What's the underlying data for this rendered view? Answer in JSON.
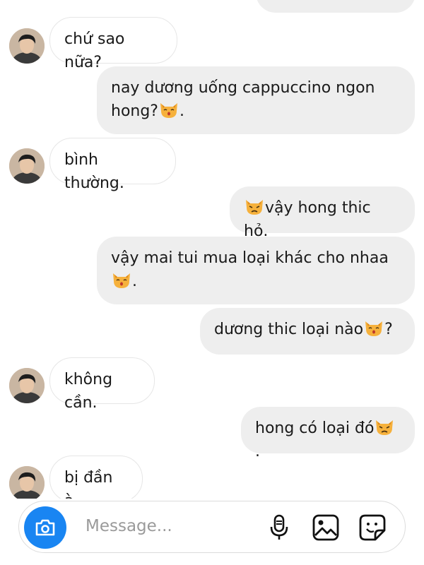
{
  "messages": [
    {
      "side": "out",
      "text": ""
    },
    {
      "side": "in",
      "text": "chứ sao nữa?"
    },
    {
      "side": "out",
      "text": "nay dương uống cappuccino ngon",
      "text2": "hong?",
      "after_emoji": "."
    },
    {
      "side": "in",
      "text": "bình thường."
    },
    {
      "side": "out",
      "text": "vậy hong thic hỏ."
    },
    {
      "side": "out",
      "text": "vậy mai tui mua loại khác cho nhaa",
      "after_emoji": "."
    },
    {
      "side": "out",
      "text": "dương thic loại nào",
      "after_emoji": "?"
    },
    {
      "side": "in",
      "text": "không cần."
    },
    {
      "side": "out",
      "text": "hong có loại đó",
      "after_emoji": "."
    },
    {
      "side": "in",
      "text": "bị đần à."
    }
  ],
  "emoji": {
    "kissing_cat": "kissing-cat-icon",
    "pouting_cat": "pouting-cat-icon"
  },
  "composer": {
    "placeholder": "Message...",
    "camera_icon": "camera-icon",
    "mic_icon": "microphone-icon",
    "gallery_icon": "gallery-icon",
    "sticker_icon": "sticker-icon"
  },
  "colors": {
    "outgoing_bubble": "#eeeeee",
    "incoming_border": "#e6e6e6",
    "camera_button": "#1985f2"
  }
}
